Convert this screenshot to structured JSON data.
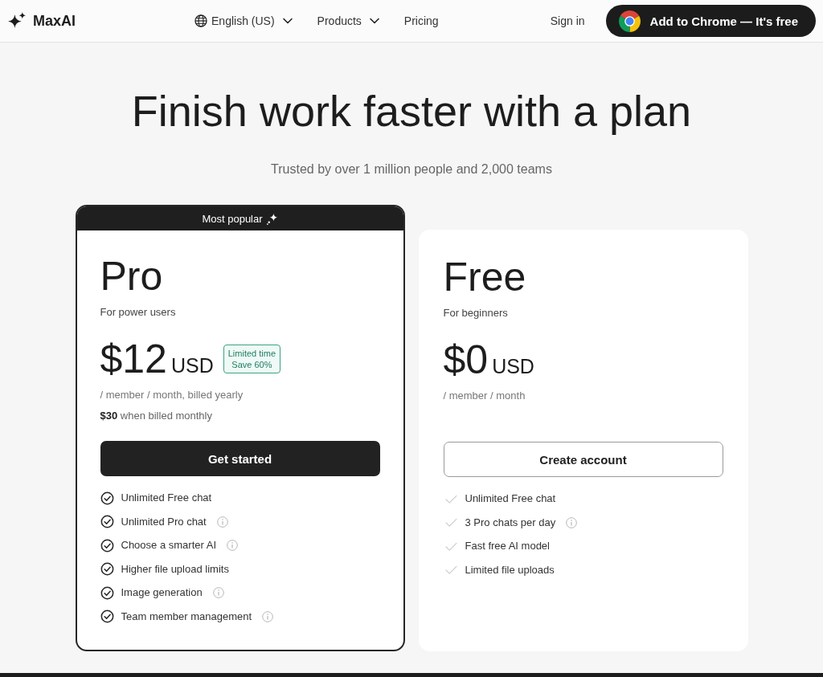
{
  "header": {
    "brand": "MaxAI",
    "nav": [
      {
        "kind": "language",
        "label": "English (US)"
      },
      {
        "kind": "menu",
        "label": "Products"
      },
      {
        "kind": "link",
        "label": "Pricing"
      }
    ],
    "sign_in": "Sign in",
    "cta": "Add to Chrome — It's free"
  },
  "hero": {
    "title": "Finish work faster with a plan",
    "subtitle": "Trusted by over 1 million people and 2,000 teams"
  },
  "plans": [
    {
      "kind": "featured",
      "ribbon": "Most popular",
      "name": "Pro",
      "audience": "For power users",
      "price": "$12",
      "currency": "USD",
      "badge": [
        "Limited time",
        "Save 60%"
      ],
      "billing": "/ member / month, billed yearly",
      "monthly_note": "**$30** when billed monthly",
      "button": "Get started",
      "features": [
        {
          "label": "Unlimited Free chat",
          "info": false
        },
        {
          "label": "Unlimited Pro chat",
          "info": true
        },
        {
          "label": "Choose a smarter AI",
          "info": true
        },
        {
          "label": "Higher file upload limits",
          "info": false
        },
        {
          "label": "Image generation",
          "info": true
        },
        {
          "label": "Team member management",
          "info": true
        }
      ]
    },
    {
      "kind": "basic",
      "name": "Free",
      "audience": "For beginners",
      "price": "$0",
      "currency": "USD",
      "billing": "/ member / month",
      "button": "Create account",
      "features": [
        {
          "label": "Unlimited Free chat",
          "info": false
        },
        {
          "label": "3 Pro chats per day",
          "info": true
        },
        {
          "label": "Fast free AI model",
          "info": false
        },
        {
          "label": "Limited file uploads",
          "info": false
        }
      ]
    }
  ]
}
